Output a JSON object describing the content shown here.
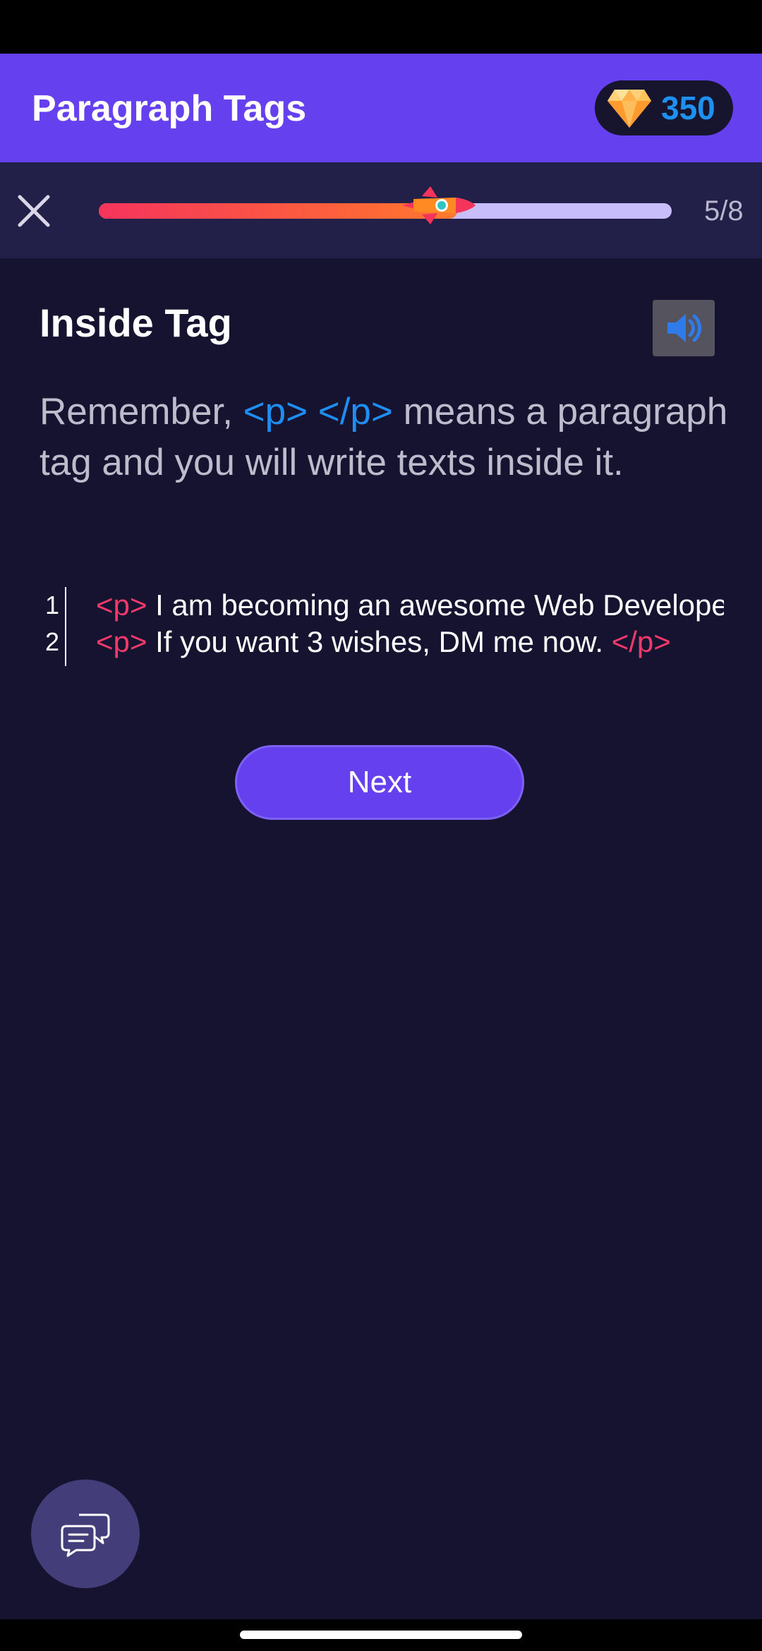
{
  "header": {
    "title": "Paragraph Tags",
    "gems": "350"
  },
  "progress": {
    "label": "5/8",
    "fraction": 0.625
  },
  "lesson": {
    "title": "Inside Tag",
    "body_before": "Remember, ",
    "body_tags": "<p> </p>",
    "body_after": " means a paragraph tag and you will write texts inside it."
  },
  "code": {
    "lines": [
      {
        "number": "1",
        "open_tag": "<p>",
        "text": " I am becoming an awesome Web Developer",
        "close_tag": ""
      },
      {
        "number": "2",
        "open_tag": "<p>",
        "text": " If you want 3 wishes, DM me now. ",
        "close_tag": "</p>"
      }
    ]
  },
  "actions": {
    "next_label": "Next"
  },
  "icons": {
    "close": "close-icon",
    "gem": "diamond-icon",
    "rocket": "rocket-icon",
    "sound": "speaker-icon",
    "chat": "chat-bubbles-icon"
  },
  "colors": {
    "app_bar": "#6440EE",
    "background": "#161331",
    "tag_blue": "#1E8EF2",
    "tag_pink": "#F2396B",
    "gem_count": "#1E90F0"
  }
}
